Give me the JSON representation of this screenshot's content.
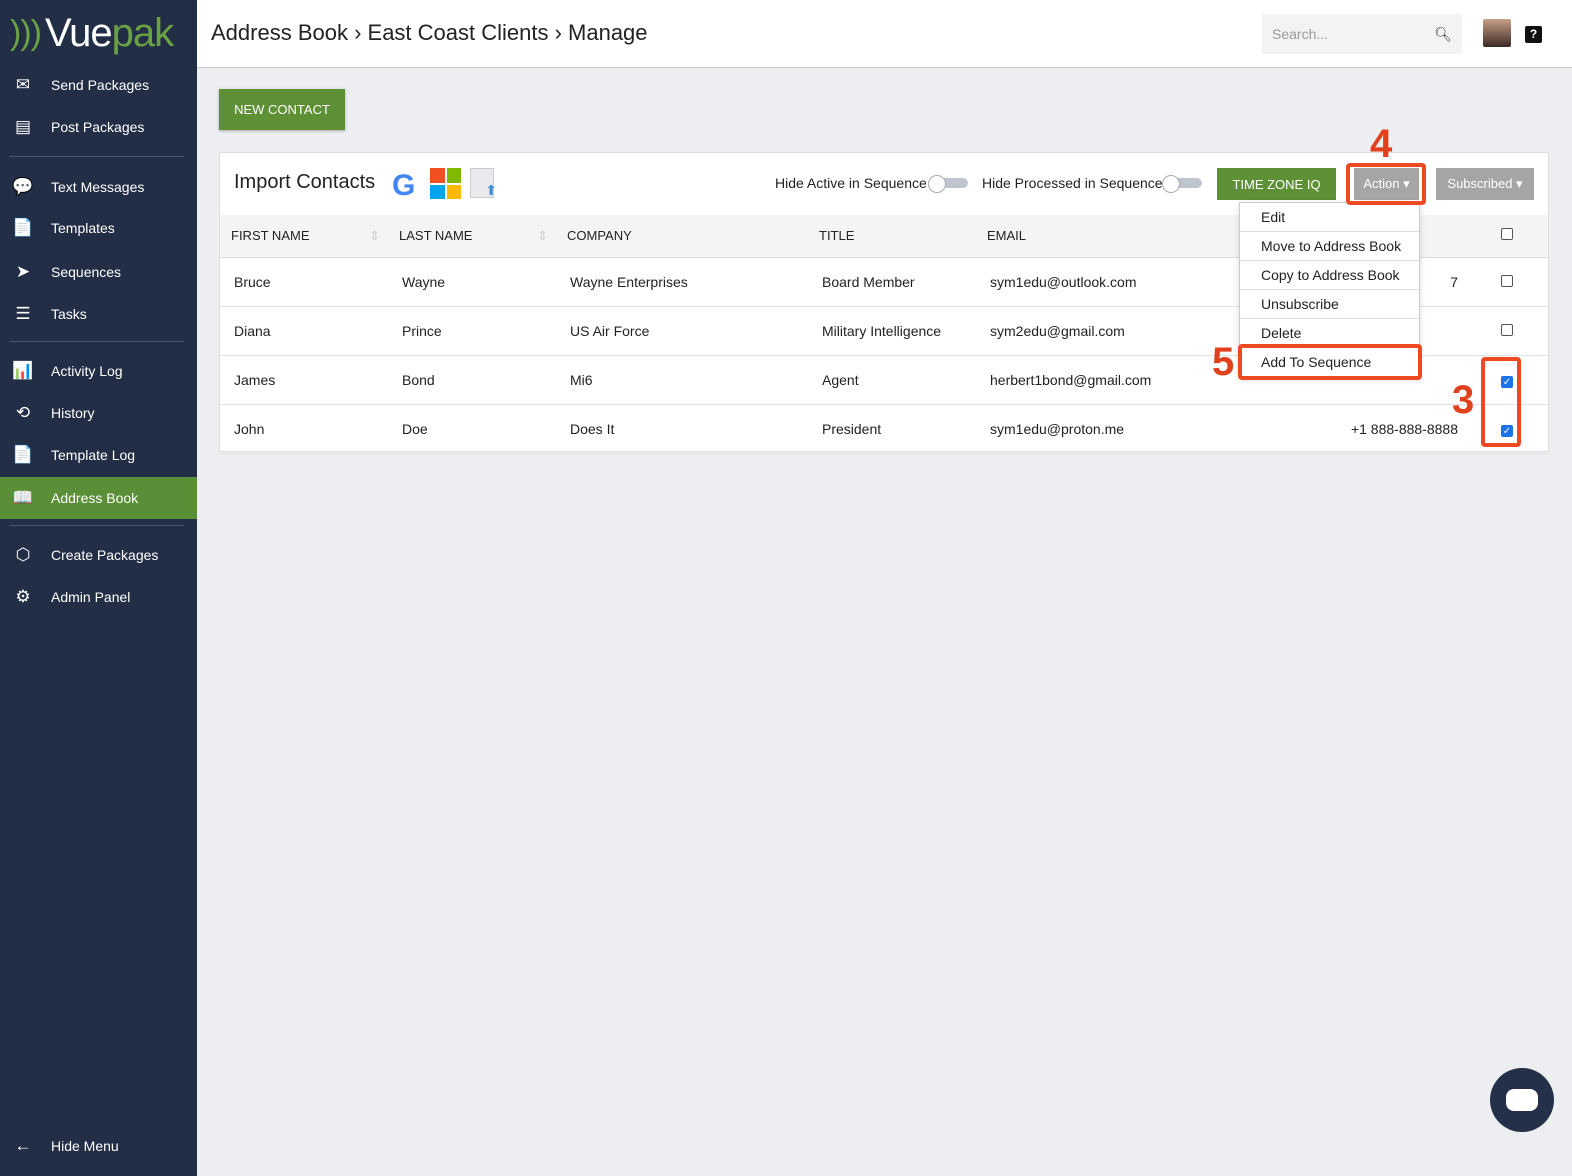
{
  "logo": {
    "part1": "Vue",
    "part2": "pak"
  },
  "sidebar": {
    "items": [
      {
        "label": "Send Packages",
        "icon": "✉"
      },
      {
        "label": "Post Packages",
        "icon": "▤"
      },
      {
        "label": "Text Messages",
        "icon": "💬"
      },
      {
        "label": "Templates",
        "icon": "📄"
      },
      {
        "label": "Sequences",
        "icon": "➤"
      },
      {
        "label": "Tasks",
        "icon": "☰"
      },
      {
        "label": "Activity Log",
        "icon": "📊"
      },
      {
        "label": "History",
        "icon": "⟲"
      },
      {
        "label": "Template Log",
        "icon": "📄"
      },
      {
        "label": "Address Book",
        "icon": "📖"
      },
      {
        "label": "Create Packages",
        "icon": "⬡"
      },
      {
        "label": "Admin Panel",
        "icon": "⚙"
      }
    ],
    "hide_menu": "Hide Menu"
  },
  "header": {
    "breadcrumb": "Address Book › East Coast Clients › Manage",
    "search_placeholder": "Search...",
    "help": "?"
  },
  "new_contact": "NEW CONTACT",
  "card": {
    "import_label": "Import Contacts",
    "google": "G",
    "hide_active": "Hide Active in Sequence",
    "hide_processed": "Hide Processed in Sequence",
    "time_zone": "TIME ZONE IQ",
    "action": "Action ▾",
    "subscribed": "Subscribed ▾"
  },
  "table": {
    "headers": [
      "FIRST NAME",
      "LAST NAME",
      "COMPANY",
      "TITLE",
      "EMAIL"
    ],
    "rows": [
      {
        "first": "Bruce",
        "last": "Wayne",
        "company": "Wayne Enterprises",
        "title": "Board Member",
        "email": "sym1edu@outlook.com",
        "phone": "7",
        "checked": false
      },
      {
        "first": "Diana",
        "last": "Prince",
        "company": "US Air Force",
        "title": "Military Intelligence",
        "email": "sym2edu@gmail.com",
        "phone": "",
        "checked": false
      },
      {
        "first": "James",
        "last": "Bond",
        "company": "Mi6",
        "title": "Agent",
        "email": "herbert1bond@gmail.com",
        "phone": "",
        "checked": true
      },
      {
        "first": "John",
        "last": "Doe",
        "company": "Does It",
        "title": "President",
        "email": "sym1edu@proton.me",
        "phone": "+1 888-888-8888",
        "checked": true
      }
    ]
  },
  "menu": [
    "Edit",
    "Move to Address Book",
    "Copy to Address Book",
    "Unsubscribe",
    "Delete",
    "Add To Sequence"
  ],
  "annotations": {
    "a3": "3",
    "a4": "4",
    "a5": "5"
  }
}
